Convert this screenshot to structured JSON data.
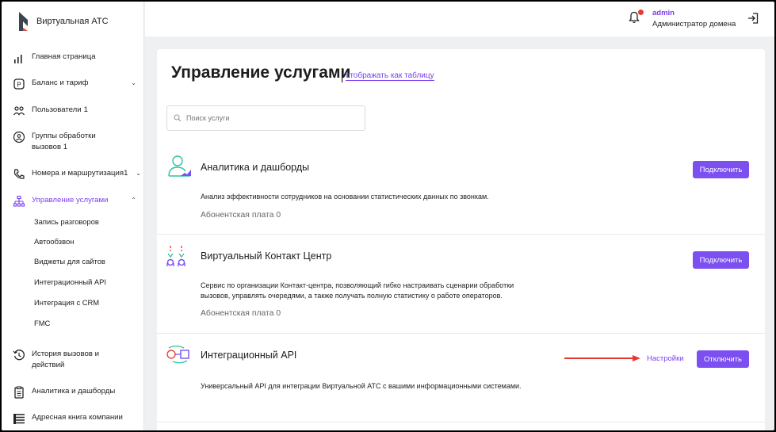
{
  "app": {
    "title": "Виртуальная АТС"
  },
  "sidebar": {
    "items": [
      {
        "label": "Главная страница",
        "icon": "bar-chart-icon"
      },
      {
        "label": "Баланс и тариф",
        "icon": "balance-icon"
      },
      {
        "label": "Пользователи",
        "count": "1",
        "icon": "users-icon"
      },
      {
        "label_1": "Группы обработки",
        "label_2": "вызовов",
        "count": "1",
        "icon": "call-group-icon"
      },
      {
        "label": "Номера и маршрутизация",
        "count": "1",
        "icon": "phone-routing-icon"
      },
      {
        "label": "Управление услугами",
        "icon": "services-icon"
      },
      {
        "label_1": "История вызовов и",
        "label_2": "действий",
        "icon": "history-icon"
      },
      {
        "label": "Аналитика и дашборды",
        "icon": "analytics-icon"
      },
      {
        "label": "Адресная книга компании",
        "icon": "address-book-icon"
      }
    ],
    "sub_items": [
      "Запись разговоров",
      "Автообзвон",
      "Виджеты для сайтов",
      "Интеграционный API",
      "Интеграция с CRM",
      "FMC"
    ]
  },
  "header": {
    "user_name": "admin",
    "user_role": "Администратор домена"
  },
  "main": {
    "title": "Управление услугами",
    "view_link": "отображать как таблицу",
    "search_placeholder": "Поиск услуги",
    "services": [
      {
        "title": "Аналитика и дашборды",
        "description": "Анализ эффективности сотрудников на основании статистических данных по звонкам.",
        "fee": "Абонентская плата 0",
        "button": "Подключить"
      },
      {
        "title": "Виртуальный Контакт Центр",
        "description_1": "Сервис по организации Контакт-центра, позволяющий гибко настраивать сценарии обработки",
        "description_2": "вызовов, управлять очередями, а также получать полную статистику о работе операторов.",
        "fee": "Абонентская плата 0",
        "button": "Подключить"
      },
      {
        "title": "Интеграционный API",
        "description": "Универсальный API для интеграции Виртуальной АТС с вашими информационными системами.",
        "settings": "Настройки",
        "button": "Отключить"
      }
    ]
  },
  "colors": {
    "accent": "#7b4ff0",
    "annotation_arrow": "#e53935",
    "notification": "#e53935"
  }
}
